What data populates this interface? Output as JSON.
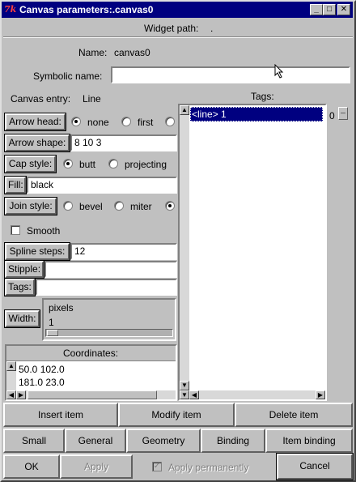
{
  "window": {
    "title": "Canvas parameters:.canvas0",
    "minimize": "_",
    "maximize": "□",
    "close": "✕"
  },
  "widget_path": {
    "label": "Widget path:",
    "value": "."
  },
  "name": {
    "label": "Name:",
    "value": "canvas0"
  },
  "symbolic_name": {
    "label": "Symbolic name:",
    "value": ""
  },
  "canvas_entry": {
    "label": "Canvas entry:",
    "value": "Line"
  },
  "arrow_head": {
    "button": "Arrow head:",
    "options": [
      "none",
      "first",
      ""
    ],
    "selected": "none"
  },
  "arrow_shape": {
    "button": "Arrow shape:",
    "value": "8 10 3"
  },
  "cap_style": {
    "button": "Cap style:",
    "options": [
      "butt",
      "projecting"
    ],
    "selected": "butt"
  },
  "fill": {
    "button": "Fill:",
    "value": "black"
  },
  "join_style": {
    "button": "Join style:",
    "options": [
      "bevel",
      "miter",
      ""
    ],
    "selected": ""
  },
  "smooth": {
    "label": "Smooth",
    "checked": false
  },
  "spline_steps": {
    "button": "Spline steps:",
    "value": "12"
  },
  "stipple": {
    "button": "Stipple:",
    "value": ""
  },
  "tags_field": {
    "button": "Tags:",
    "value": ""
  },
  "width": {
    "button": "Width:",
    "unit": "pixels",
    "value": "1"
  },
  "coordinates": {
    "header": "Coordinates:",
    "lines": [
      "50.0 102.0",
      "181.0 23.0"
    ]
  },
  "tags_list": {
    "header": "Tags:",
    "items": [
      "<line>  1"
    ],
    "side_value": "0"
  },
  "item_buttons": {
    "insert": "Insert item",
    "modify": "Modify item",
    "delete": "Delete item"
  },
  "tabs": [
    "Small",
    "General",
    "Geometry",
    "Binding",
    "Item binding"
  ],
  "footer": {
    "ok": "OK",
    "apply": "Apply",
    "apply_perm": "Apply permanently",
    "cancel": "Cancel"
  }
}
